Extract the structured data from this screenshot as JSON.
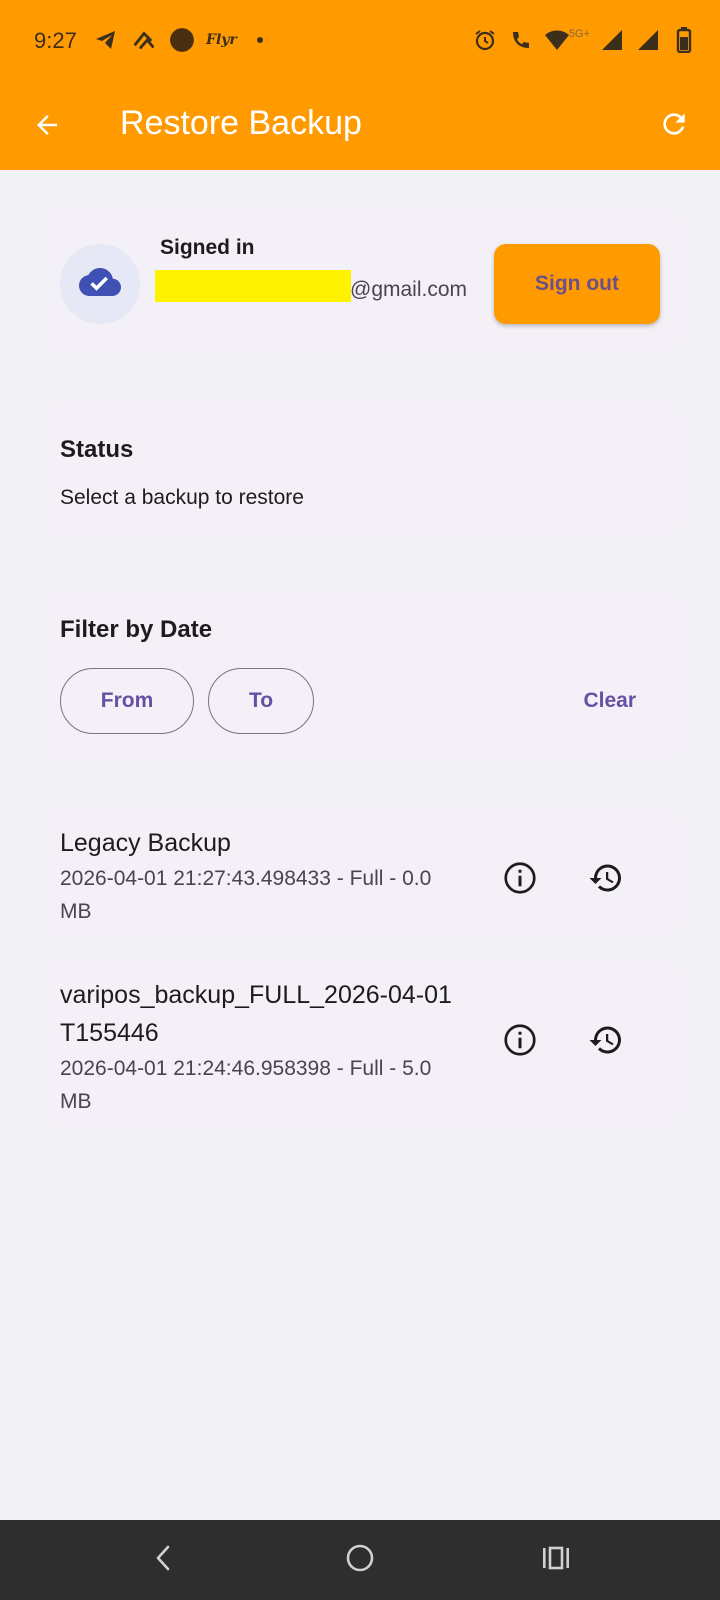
{
  "status_bar": {
    "time": "9:27",
    "carrier_label": "Flyr",
    "network_label": "5G+",
    "left_icons": [
      "telegram-icon",
      "fold-icon",
      "circle-icon",
      "flyr-icon",
      "dot-icon"
    ],
    "right_icons": [
      "alarm-icon",
      "wifi-call-icon",
      "wifi-icon",
      "signal-icon",
      "signal-icon",
      "battery-icon"
    ]
  },
  "app_bar": {
    "title": "Restore Backup",
    "back_icon": "arrow-back-icon",
    "refresh_icon": "refresh-icon",
    "background": "#ff9a00"
  },
  "account": {
    "status": "Signed in",
    "email_visible": "@gmail.com",
    "sign_out_label": "Sign out",
    "icon": "cloud-done-icon"
  },
  "status_card": {
    "title": "Status",
    "message": "Select a backup to restore"
  },
  "filter": {
    "title": "Filter by Date",
    "from_label": "From",
    "to_label": "To",
    "clear_label": "Clear"
  },
  "backups": [
    {
      "name": "Legacy Backup",
      "meta": "2026-04-01 21:27:43.498433 - Full - 0.0 MB"
    },
    {
      "name": "varipos_backup_FULL_2026-04-01T155446",
      "meta": "2026-04-01 21:24:46.958398 - Full - 5.0 MB"
    }
  ],
  "nav_bar": {
    "icons": [
      "back-nav-icon",
      "home-nav-icon",
      "recents-nav-icon"
    ]
  },
  "colors": {
    "accent": "#ff9a00",
    "primary_text": "#6750a4",
    "card_bg": "#f4f0f7",
    "redaction": "#fff200"
  }
}
